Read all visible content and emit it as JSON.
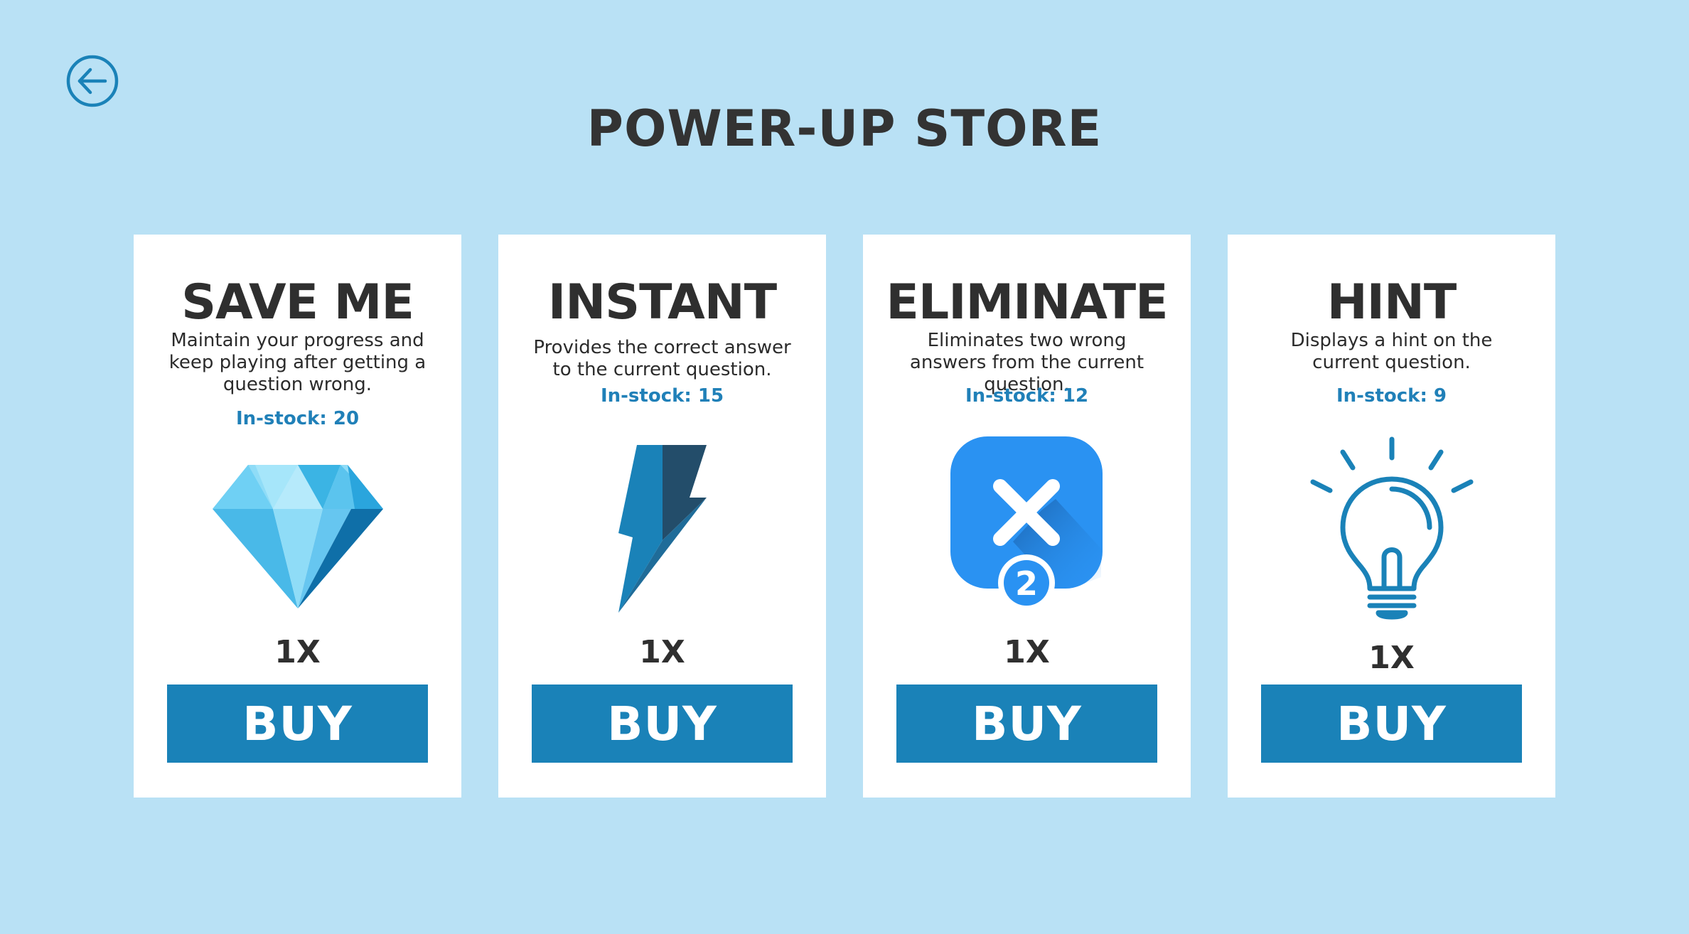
{
  "header": {
    "title": "POWER-UP STORE",
    "back_icon": "arrow-left-circle-icon"
  },
  "colors": {
    "background": "#b9e1f5",
    "card": "#ffffff",
    "accent": "#1a82b8",
    "stock_text": "#2080b8",
    "title_text": "#333333"
  },
  "cards": [
    {
      "title": "SAVE ME",
      "description": "Maintain your progress and keep playing after getting a question wrong.",
      "stock": "In-stock: 20",
      "icon": "diamond-icon",
      "quantity": "1X",
      "buy_label": "BUY"
    },
    {
      "title": "INSTANT",
      "description": "Provides the correct answer to the current question.",
      "stock": "In-stock: 15",
      "icon": "lightning-bolt-icon",
      "quantity": "1X",
      "buy_label": "BUY"
    },
    {
      "title": "ELIMINATE",
      "description": "Eliminates two wrong answers from the current question.",
      "stock": "In-stock: 12",
      "icon": "eliminate-x-icon",
      "icon_badge": "2",
      "quantity": "1X",
      "buy_label": "BUY"
    },
    {
      "title": "HINT",
      "description": "Displays a hint on the current question.",
      "stock": "In-stock: 9",
      "icon": "lightbulb-icon",
      "quantity": "1X",
      "buy_label": "BUY"
    }
  ]
}
